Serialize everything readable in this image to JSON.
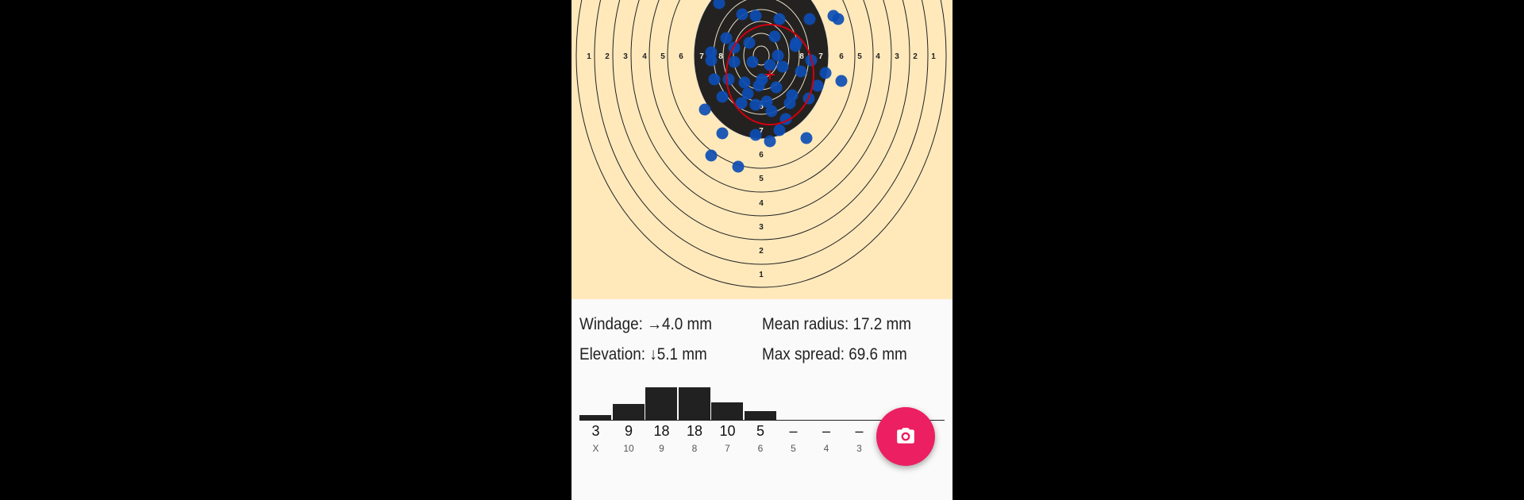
{
  "target": {
    "horizontal_ring_numbers_left": [
      "1",
      "2",
      "3",
      "4",
      "5",
      "6",
      "7",
      "8"
    ],
    "horizontal_ring_numbers_right": [
      "8",
      "7",
      "6",
      "5",
      "4",
      "3",
      "2",
      "1"
    ],
    "vertical_ring_numbers": [
      "8",
      "7",
      "6",
      "5",
      "4",
      "3",
      "2",
      "1"
    ]
  },
  "stats": {
    "windage": "Windage: →4.0 mm",
    "elevation": "Elevation: ↓5.1 mm",
    "mean_radius": "Mean radius: 17.2 mm",
    "max_spread": "Max spread: 69.6 mm"
  },
  "histogram": {
    "bins": [
      {
        "label": "X",
        "count": "3",
        "value": 3
      },
      {
        "label": "10",
        "count": "9",
        "value": 9
      },
      {
        "label": "9",
        "count": "18",
        "value": 18
      },
      {
        "label": "8",
        "count": "18",
        "value": 18
      },
      {
        "label": "7",
        "count": "10",
        "value": 10
      },
      {
        "label": "6",
        "count": "5",
        "value": 5
      },
      {
        "label": "5",
        "count": "–",
        "value": 0
      },
      {
        "label": "4",
        "count": "–",
        "value": 0
      },
      {
        "label": "3",
        "count": "–",
        "value": 0
      }
    ]
  },
  "colors": {
    "accent": "#ec1f62",
    "paper": "#ffe9bb",
    "shot": "#0d4db3",
    "group_circle": "#d00010"
  },
  "fab": {
    "icon": "camera-icon"
  }
}
